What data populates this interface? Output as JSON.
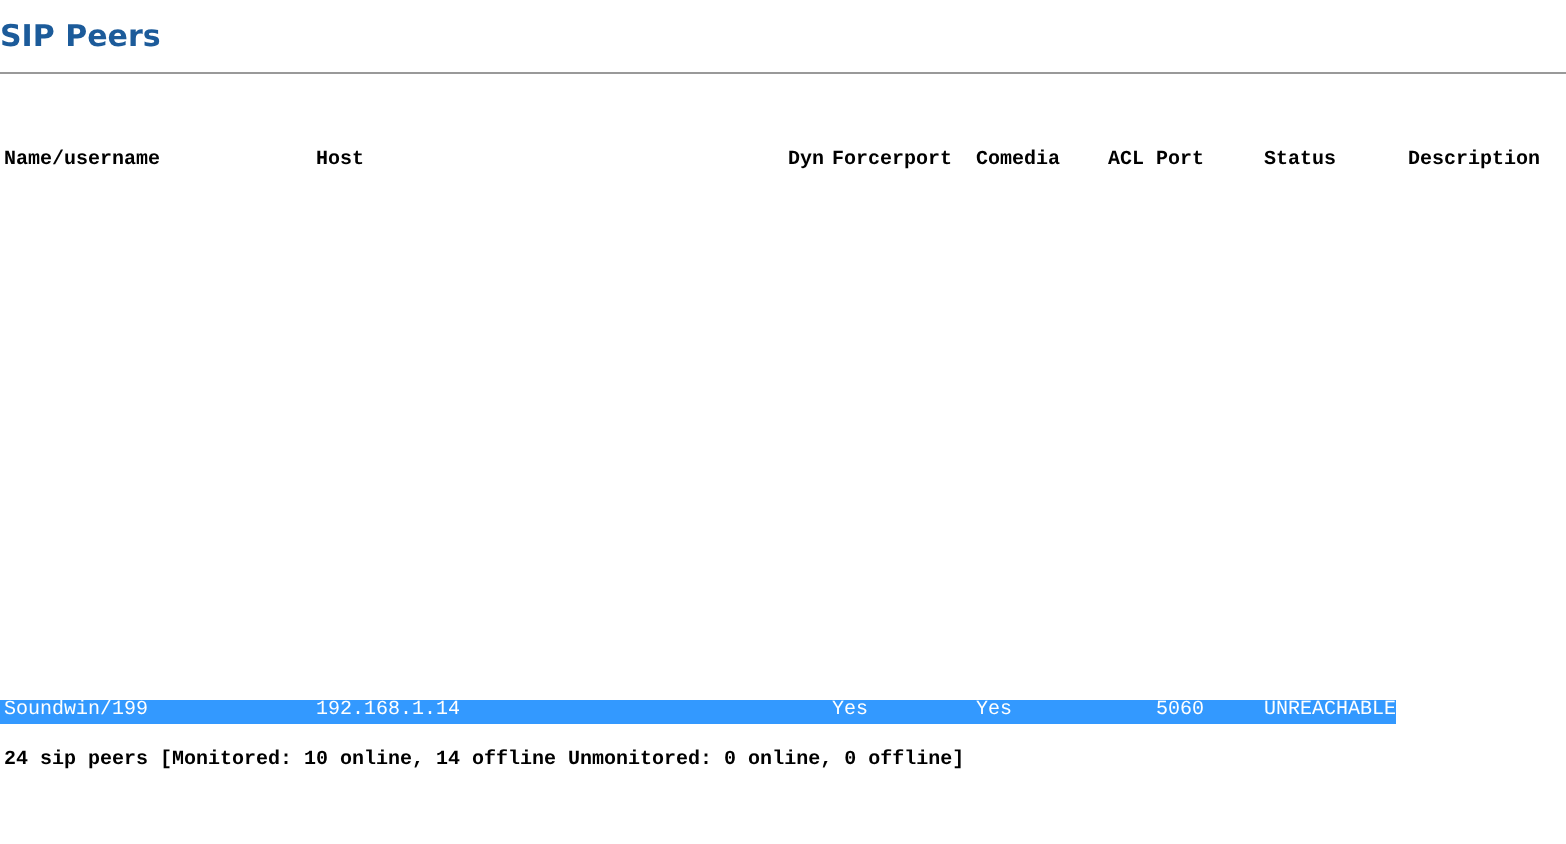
{
  "title": "SIP Peers",
  "table": {
    "columns": [
      "Name/username",
      "Host",
      "Dyn",
      "Forcerport",
      "Comedia",
      "ACL",
      "Port",
      "Status",
      "Description"
    ],
    "rows": [
      {
        "selected": true,
        "cells": [
          "Soundwin/199",
          "192.168.1.14",
          "",
          "Yes",
          "Yes",
          "",
          "5060",
          "UNREACHABLE",
          ""
        ]
      }
    ]
  },
  "summary": "24 sip peers [Monitored: 10 online, 14 offline Unmonitored: 0 online, 0 offline]"
}
